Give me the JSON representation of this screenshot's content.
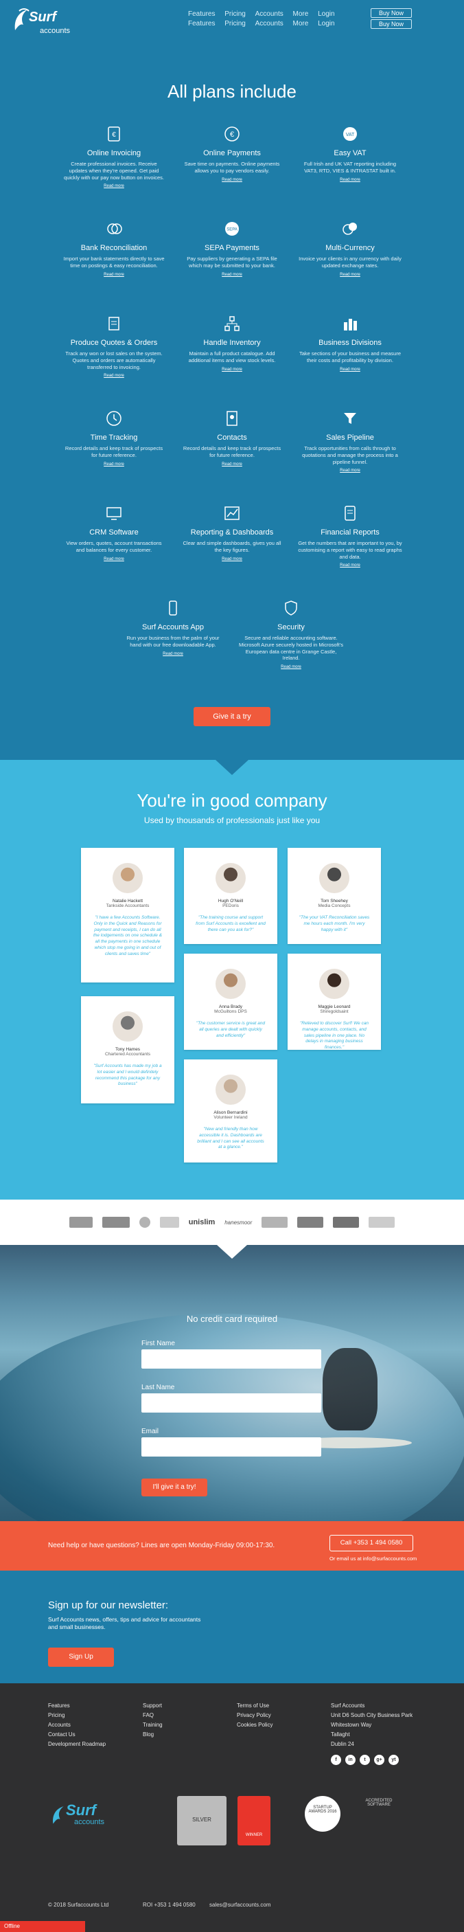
{
  "header": {
    "logo_brand": "Surf",
    "logo_sub": "accounts",
    "nav_row1": [
      "Features",
      "Pricing",
      "Accounts",
      "More",
      "Login"
    ],
    "nav_row2": [
      "Features",
      "Pricing",
      "Accounts",
      "More",
      "Login"
    ],
    "buy_now_1": "Buy Now",
    "buy_now_2": "Buy Now"
  },
  "plans": {
    "title": "All plans include",
    "read_more": "Read more",
    "features": [
      {
        "title": "Online Invoicing",
        "desc": "Create professional invoices. Receive updates when they're opened. Get paid quickly with our pay now button on invoices.",
        "icon": "invoice-icon"
      },
      {
        "title": "Online Payments",
        "desc": "Save time on payments. Online payments allows you to pay vendors easily.",
        "icon": "euro-icon"
      },
      {
        "title": "Easy VAT",
        "desc": "Full Irish and UK VAT reporting including VAT3, RTD, VIES & INTRASTAT built in.",
        "icon": "vat-icon"
      },
      {
        "title": "Bank Reconciliation",
        "desc": "Import your bank statements directly to save time on postings & easy reconciliation.",
        "icon": "bank-icon"
      },
      {
        "title": "SEPA Payments",
        "desc": "Pay suppliers by generating a SEPA file which may be submitted to your bank.",
        "icon": "sepa-icon"
      },
      {
        "title": "Multi-Currency",
        "desc": "Invoice your clients in any currency with daily updated exchange rates.",
        "icon": "currency-icon"
      },
      {
        "title": "Produce Quotes & Orders",
        "desc": "Track any won or lost sales on the system. Quotes and orders are automatically transferred to invoicing.",
        "icon": "quotes-icon"
      },
      {
        "title": "Handle Inventory",
        "desc": "Maintain a full product catalogue. Add additional items and view stock levels.",
        "icon": "inventory-icon"
      },
      {
        "title": "Business Divisions",
        "desc": "Take sections of your business and measure their costs and profitability by division.",
        "icon": "divisions-icon"
      },
      {
        "title": "Time Tracking",
        "desc": "Record details and keep track of prospects for future reference.",
        "icon": "clock-icon"
      },
      {
        "title": "Contacts",
        "desc": "Record details and keep track of prospects for future reference.",
        "icon": "contacts-icon"
      },
      {
        "title": "Sales Pipeline",
        "desc": "Track opportunities from calls through to quotations and manage the process into a pipeline funnel.",
        "icon": "funnel-icon"
      },
      {
        "title": "CRM Software",
        "desc": "View orders, quotes, account transactions and balances for every customer.",
        "icon": "crm-icon"
      },
      {
        "title": "Reporting & Dashboards",
        "desc": "Clear and simple dashboards, gives you all the key figures.",
        "icon": "chart-icon"
      },
      {
        "title": "Financial Reports",
        "desc": "Get the numbers that are important to you, by customising a report with easy to read graphs and data.",
        "icon": "report-icon"
      },
      {
        "title": "Surf Accounts App",
        "desc": "Run your business from the palm of your hand with our free downloadable App.",
        "icon": "phone-icon"
      },
      {
        "title": "Security",
        "desc": "Secure and reliable accounting software. Microsoft Azure securely hosted in Microsoft's European data centre in Grange Castle, Ireland.",
        "icon": "shield-icon"
      }
    ],
    "cta": "Give it a try"
  },
  "company": {
    "title": "You're in good company",
    "tagline": "Used by thousands of professionals just like you",
    "testimonials": [
      {
        "name": "Natalie Hackett",
        "company": "Tankside Accountants",
        "quote": "\"I have a few Accounts Software. Only in the Quick and Reasons for payment and receipts, I can do all the lodgements on one schedule & all the payments in one schedule which stop me going in and out of clients and saves time\""
      },
      {
        "name": "Hugh O'Neill",
        "company": "PEDoris",
        "quote": "\"The training course and support from Surf Accounts is excellent and there can you ask for?\""
      },
      {
        "name": "Tom Sheehey",
        "company": "Media Concepts",
        "quote": "\"The your VAT Reconciliation saves me hours each month. I'm very happy with it\""
      },
      {
        "name": "Anna Brady",
        "company": "McGuiltons DPS",
        "quote": "\"The customer service is great and all queries are dealt with quickly and efficiently\""
      },
      {
        "name": "Maggie Leonard",
        "company": "Shiregoldsaint",
        "quote": "\"Relieved to discover Surf! We can manage accounts, contacts, and sales pipeline in one place. No delays in managing business finances.\""
      },
      {
        "name": "Tony Hames",
        "company": "Chartered Accountants",
        "quote": "\"Surf Accounts has made my job a lot easier and I would definitely recommend this package for any business\""
      },
      {
        "name": "Alison Bernardini",
        "company": "Volunteer Ireland",
        "quote": "\"New and friendly than how accessible it is. Dashboards are brilliant and I can see all accounts at a glance.\""
      }
    ]
  },
  "logos": [
    "partner-logo-1",
    "partner-logo-2",
    "partner-logo-3",
    "unislim",
    "hanesmoor",
    "partner-logo-6",
    "partner-logo-7",
    "partner-logo-8",
    "partner-logo-9"
  ],
  "logo_text_unislim": "unislim",
  "logo_text_hanes": "hanesmoor",
  "signup": {
    "title": "No credit card required",
    "first_name_label": "First Name",
    "last_name_label": "Last Name",
    "email_label": "Email",
    "button": "I'll give it a try!"
  },
  "help": {
    "text": "Need help or have questions? Lines are open Monday-Friday 09:00-17:30.",
    "phone": "Call +353 1 494 0580",
    "email": "Or email us at info@surfaccounts.com"
  },
  "newsletter": {
    "title": "Sign up for our newsletter:",
    "text": "Surf Accounts news, offers, tips and advice for accountants and small businesses.",
    "button": "Sign Up"
  },
  "footer": {
    "col1": [
      "Features",
      "Pricing",
      "Accounts",
      "Contact Us",
      "Development Roadmap"
    ],
    "col2": [
      "Support",
      "FAQ",
      "Training",
      "Blog"
    ],
    "col3": [
      "Terms of Use",
      "Privacy Policy",
      "Cookies Policy"
    ],
    "address": [
      "Surf Accounts",
      "Unit D6 South City Business Park",
      "Whitestown Way",
      "Tallaght",
      "Dublin 24"
    ],
    "social": [
      "f",
      "in",
      "t",
      "g+",
      "yt"
    ],
    "copyright": "© 2018 Surfaccounts Ltd",
    "phone": "ROI +353 1 494 0580",
    "email": "sales@surfaccounts.com",
    "badges": [
      "SILVER",
      "WINNER",
      "STARTUP AWARDS 2016",
      "ACCREDITED SOFTWARE"
    ],
    "offline": "Offline"
  }
}
